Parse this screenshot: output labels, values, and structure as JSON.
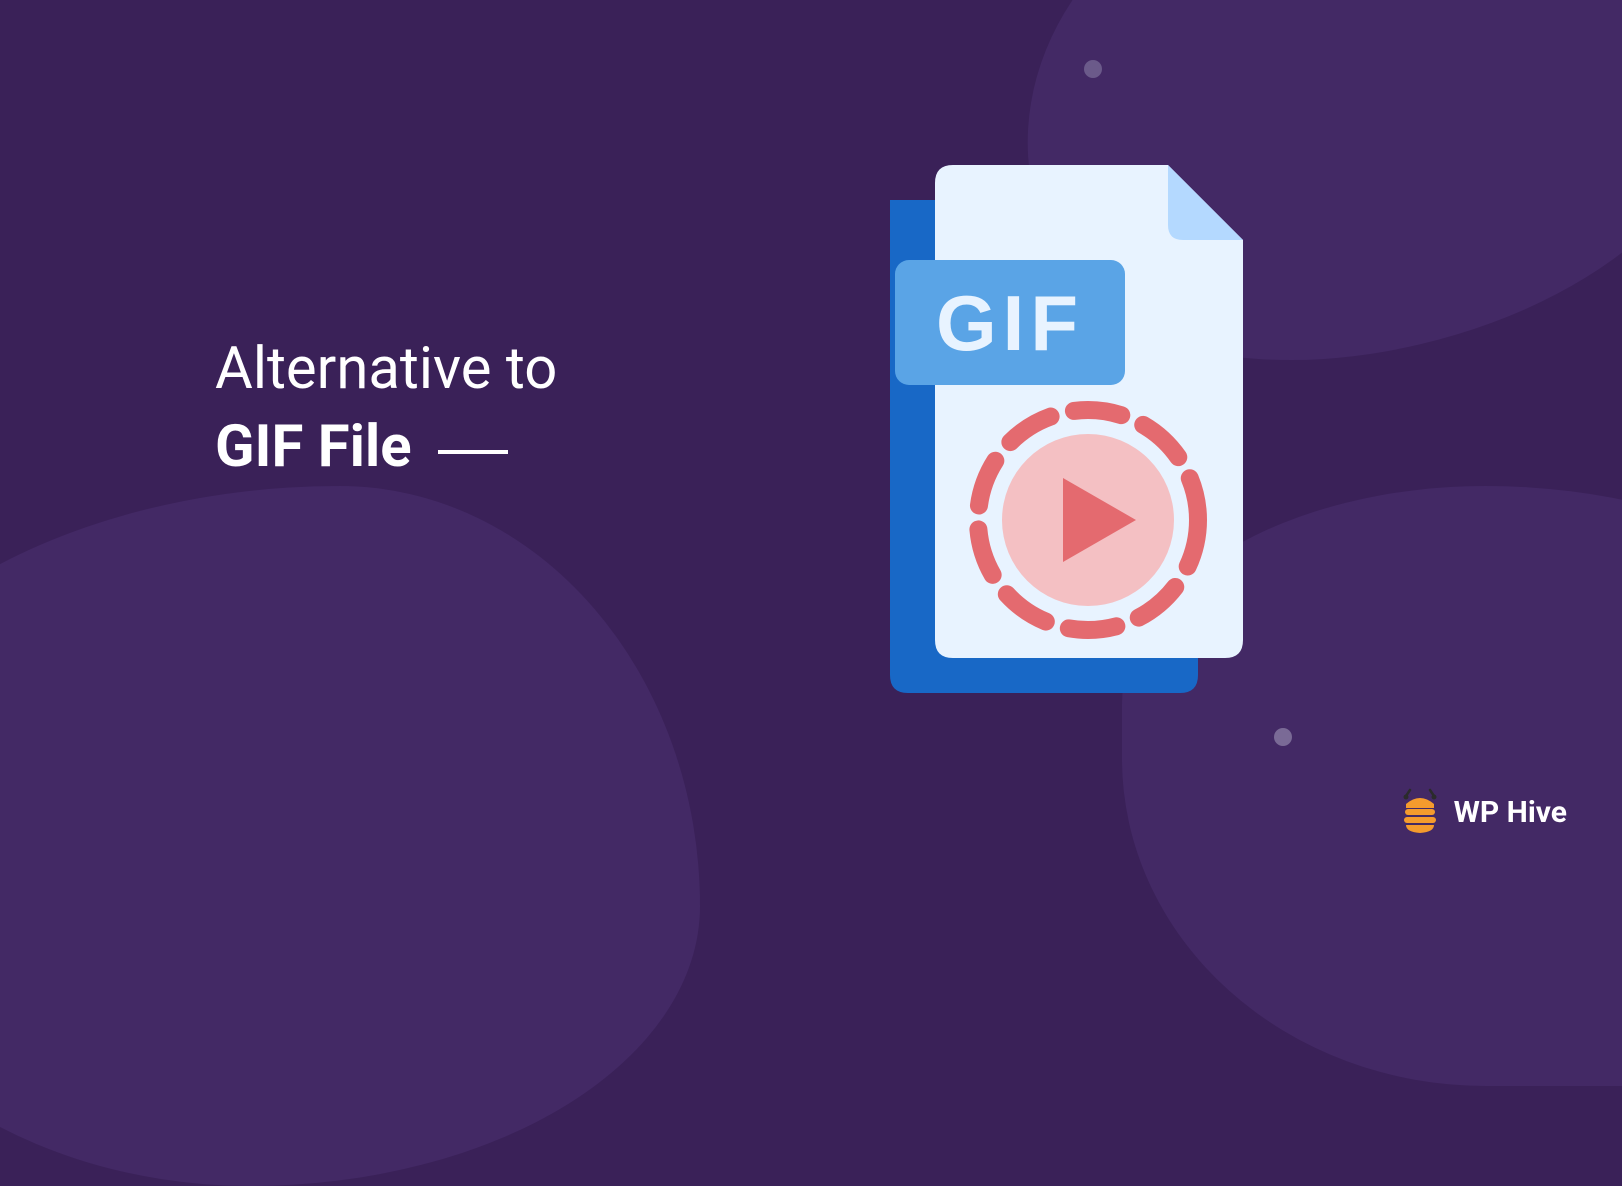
{
  "heading": {
    "line1": "Alternative to",
    "line2": "GIF File"
  },
  "file_badge": "GIF",
  "brand": {
    "name": "WP Hive"
  },
  "colors": {
    "background": "#3a2158",
    "blob": "#432965",
    "file_back": "#1868c6",
    "file_front": "#e8f3ff",
    "file_fold": "#b4d9ff",
    "badge_bg": "#5aa4e6",
    "badge_text": "#e8f3ff",
    "play_ring": "#e46a6f",
    "play_inner": "#f4c0c3",
    "play_arrow": "#e46a6f",
    "brand_orange": "#f59b2d",
    "brand_dark": "#2b2b2b"
  }
}
